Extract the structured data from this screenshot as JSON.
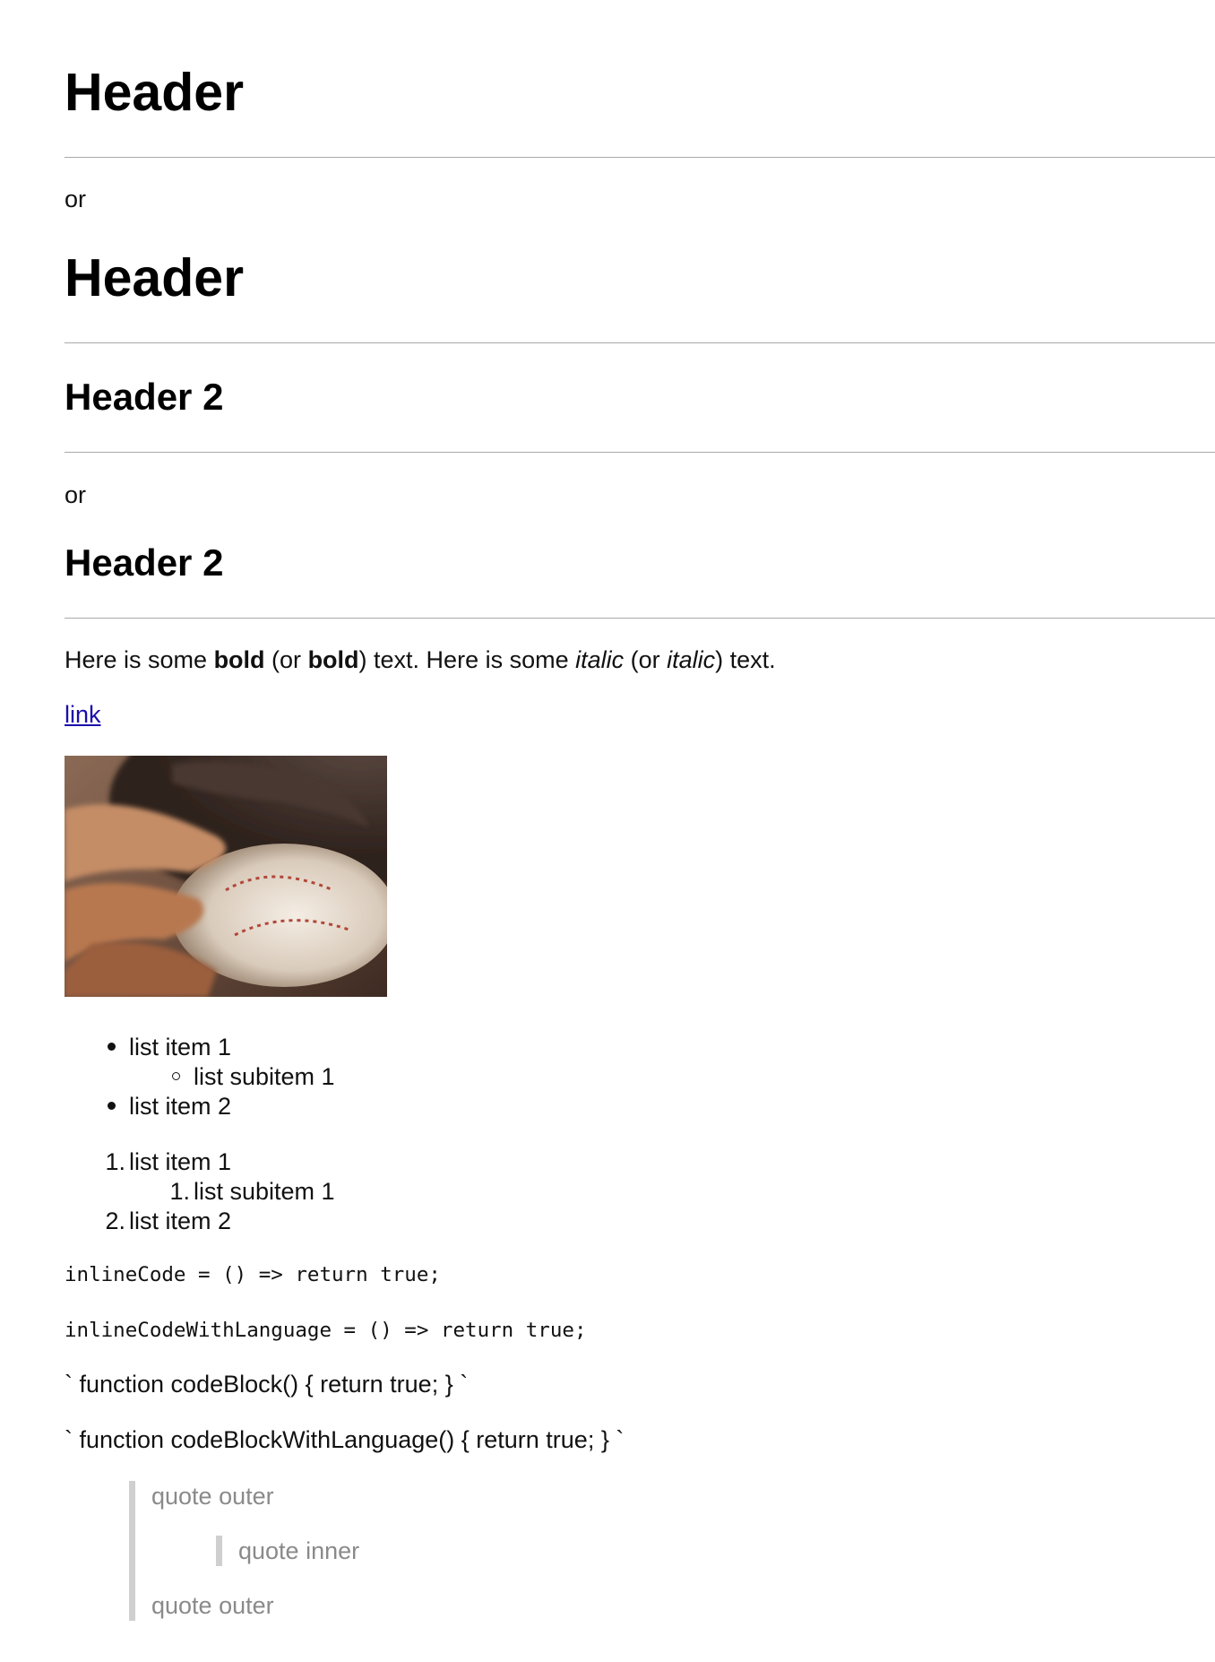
{
  "headings": {
    "h1_first": "Header",
    "or_1": "or",
    "h1_second": "Header",
    "h2_first": "Header 2",
    "or_2": "or",
    "h2_second": "Header 2"
  },
  "paragraph": {
    "p1": "Here is some ",
    "bold_1": "bold",
    "p2": " (or ",
    "bold_2": "bold",
    "p3": ") text. Here is some ",
    "italic_1": "italic",
    "p4": " (or ",
    "italic_2": "italic",
    "p5": ") text."
  },
  "link": {
    "text": "link"
  },
  "image": {
    "alt": "baseball in glove",
    "description_icon": "baseball-glove-image"
  },
  "unordered_list": {
    "item_1": "list item 1",
    "subitem_1": "list subitem 1",
    "item_2": "list item 2"
  },
  "ordered_list": {
    "num_1": "1.",
    "item_1": "list item 1",
    "sub_num_1": "1.",
    "subitem_1": "list subitem 1",
    "num_2": "2.",
    "item_2": "list item 2"
  },
  "code": {
    "inline": "inlineCode = () => return true;",
    "inline_lang": "inlineCodeWithLanguage = () => return true;",
    "block": "` function codeBlock() { return true; } `",
    "block_lang": "` function codeBlockWithLanguage() { return true; } `"
  },
  "quotes": {
    "outer_1": "quote outer",
    "inner": "quote inner",
    "outer_2": "quote outer"
  },
  "colors": {
    "link": "#1a0dab",
    "quote_text": "#8a8a8a",
    "quote_bar": "#cfcfcf",
    "rule": "#a9a9a9"
  }
}
